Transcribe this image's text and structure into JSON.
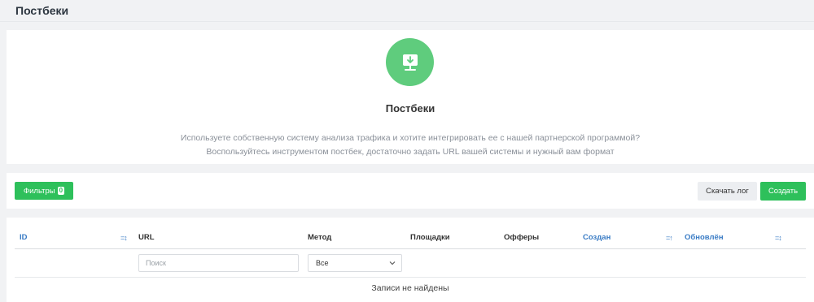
{
  "page": {
    "title": "Постбеки"
  },
  "hero": {
    "icon": "download-to-server-icon",
    "title": "Постбеки",
    "line1": "Используете собственную систему анализа трафика и хотите интегрировать ее с нашей партнерской программой?",
    "line2": "Воспользуйтесь инструментом постбек, достаточно задать URL вашей системы и нужный вам формат"
  },
  "toolbar": {
    "filters_label": "Фильтры",
    "filters_count": "0",
    "download_log_label": "Скачать лог",
    "create_label": "Создать"
  },
  "table": {
    "columns": {
      "id": "ID",
      "url": "URL",
      "method": "Метод",
      "sites": "Площадки",
      "offers": "Офферы",
      "created": "Создан",
      "updated": "Обновлён"
    },
    "filters": {
      "search_placeholder": "Поиск",
      "method_value": "Все"
    },
    "empty_text": "Записи не найдены"
  },
  "colors": {
    "accent_green": "#2ec05b",
    "icon_circle": "#5fcc7d",
    "link_blue": "#3a7cc5"
  }
}
